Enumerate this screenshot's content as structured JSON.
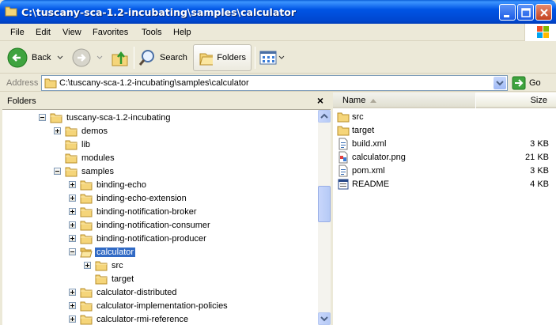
{
  "window": {
    "title": "C:\\tuscany-sca-1.2-incubating\\samples\\calculator"
  },
  "menu": [
    "File",
    "Edit",
    "View",
    "Favorites",
    "Tools",
    "Help"
  ],
  "toolbar": {
    "back": "Back",
    "search": "Search",
    "folders": "Folders"
  },
  "address": {
    "label": "Address",
    "value": "C:\\tuscany-sca-1.2-incubating\\samples\\calculator",
    "go": "Go"
  },
  "folders_pane": {
    "title": "Folders",
    "close": "×"
  },
  "tree": [
    {
      "label": "tuscany-sca-1.2-incubating",
      "expander": "minus"
    },
    {
      "label": "demos",
      "expander": "plus"
    },
    {
      "label": "lib",
      "expander": "none"
    },
    {
      "label": "modules",
      "expander": "none"
    },
    {
      "label": "samples",
      "expander": "minus"
    },
    {
      "label": "binding-echo",
      "expander": "plus"
    },
    {
      "label": "binding-echo-extension",
      "expander": "plus"
    },
    {
      "label": "binding-notification-broker",
      "expander": "plus"
    },
    {
      "label": "binding-notification-consumer",
      "expander": "plus"
    },
    {
      "label": "binding-notification-producer",
      "expander": "plus"
    },
    {
      "label": "calculator",
      "expander": "minus",
      "selected": true
    },
    {
      "label": "src",
      "expander": "plus"
    },
    {
      "label": "target",
      "expander": "none"
    },
    {
      "label": "calculator-distributed",
      "expander": "plus"
    },
    {
      "label": "calculator-implementation-policies",
      "expander": "plus"
    },
    {
      "label": "calculator-rmi-reference",
      "expander": "plus"
    }
  ],
  "columns": {
    "name": "Name",
    "size": "Size"
  },
  "files": [
    {
      "name": "src",
      "size": "",
      "icon": "folder-icon"
    },
    {
      "name": "target",
      "size": "",
      "icon": "folder-icon"
    },
    {
      "name": "build.xml",
      "size": "3 KB",
      "icon": "xml-file-icon"
    },
    {
      "name": "calculator.png",
      "size": "21 KB",
      "icon": "image-file-icon"
    },
    {
      "name": "pom.xml",
      "size": "3 KB",
      "icon": "xml-file-icon"
    },
    {
      "name": "README",
      "size": "4 KB",
      "icon": "text-file-icon"
    }
  ],
  "colors": {
    "titlebar": "#0055E5",
    "selection": "#316AC5",
    "folder": "#F5D57A"
  }
}
